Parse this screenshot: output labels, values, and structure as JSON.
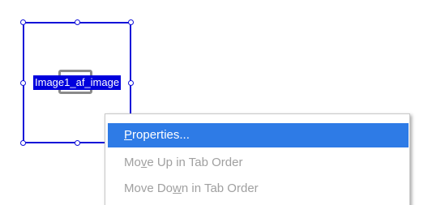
{
  "form_field": {
    "label": "Image1_af_image"
  },
  "context_menu": {
    "items": [
      {
        "pre": "",
        "mnemonic": "P",
        "post": "roperties...",
        "enabled": true,
        "highlighted": true
      },
      {
        "pre": "Mo",
        "mnemonic": "v",
        "post": "e Up in Tab Order",
        "enabled": false,
        "highlighted": false
      },
      {
        "pre": "Move Do",
        "mnemonic": "w",
        "post": "n in Tab Order",
        "enabled": false,
        "highlighted": false
      }
    ]
  },
  "colors": {
    "selection_border": "#1010d8",
    "label_background": "#0000dd",
    "menu_highlight": "#2e7be6",
    "disabled_text": "#a0a0a0"
  }
}
